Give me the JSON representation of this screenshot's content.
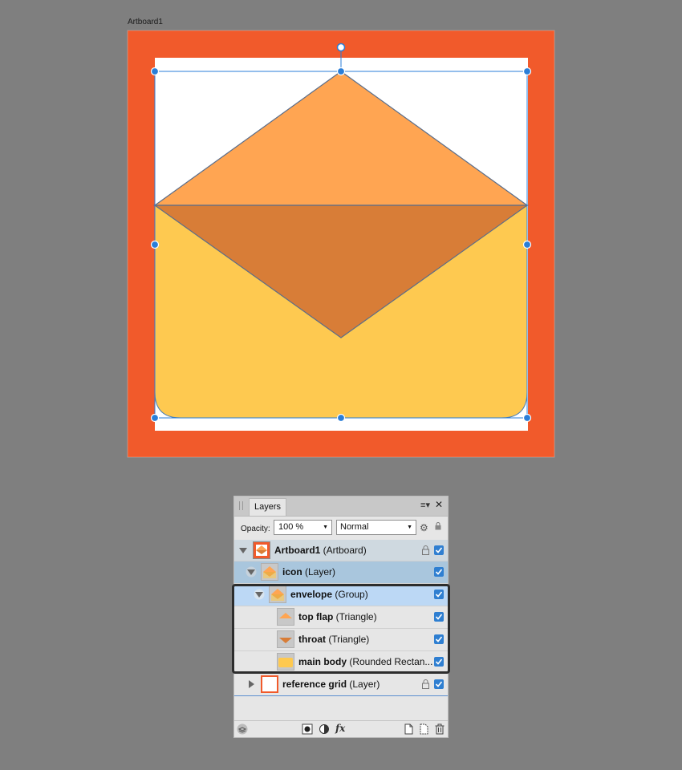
{
  "canvas": {
    "artboard_label": "Artboard1",
    "colors": {
      "artboard_bg": "#f15a2b",
      "reference_white": "#ffffff",
      "top_flap": "#ffa552",
      "throat": "#d87d37",
      "main_body": "#fec950",
      "selection": "#2a7ed8"
    }
  },
  "layers_panel": {
    "tab_label": "Layers",
    "opacity_label": "Opacity:",
    "opacity_value": "100 %",
    "blend_mode": "Normal",
    "rows": [
      {
        "bold": "Artboard1",
        "type": " (Artboard)"
      },
      {
        "bold": "icon",
        "type": " (Layer)"
      },
      {
        "bold": "envelope",
        "type": " (Group)"
      },
      {
        "bold": "top flap",
        "type": " (Triangle)"
      },
      {
        "bold": "throat",
        "type": " (Triangle)"
      },
      {
        "bold": "main body",
        "type": " (Rounded Rectan..."
      },
      {
        "bold": "reference grid",
        "type": " (Layer)"
      }
    ],
    "footer": {
      "fx_label": "fx"
    }
  }
}
